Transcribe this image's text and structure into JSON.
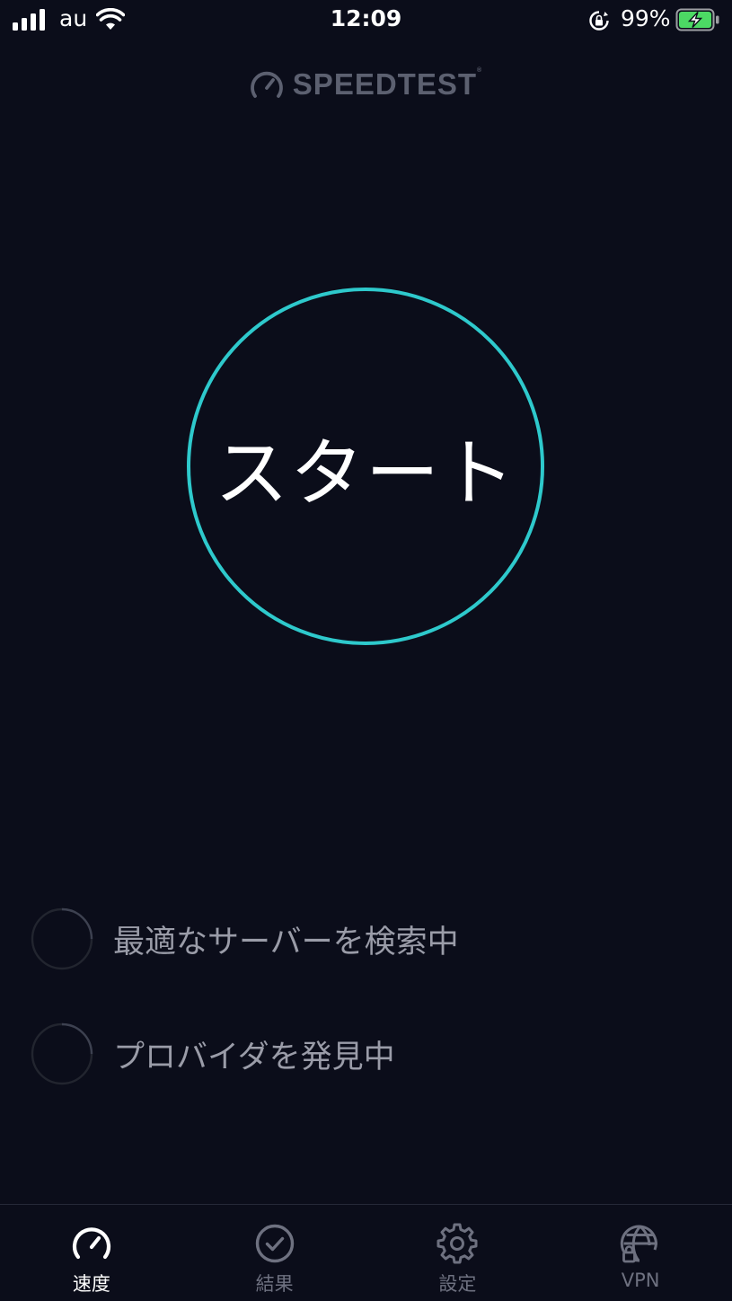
{
  "status_bar": {
    "carrier": "au",
    "time": "12:09",
    "battery_percent": "99%",
    "signal_bars": 4
  },
  "header": {
    "logo_text": "SPEEDTEST",
    "logo_icon": "speedometer-icon"
  },
  "start_button": {
    "label": "スタート",
    "ring_color": "#2ec9cc"
  },
  "status_rows": [
    {
      "text": "最適なサーバーを検索中",
      "icon": "spinner-icon"
    },
    {
      "text": "プロバイダを発見中",
      "icon": "spinner-icon"
    }
  ],
  "tab_bar": {
    "tabs": [
      {
        "label": "速度",
        "icon": "speedometer-icon",
        "active": true
      },
      {
        "label": "結果",
        "icon": "checkmark-circle-icon",
        "active": false
      },
      {
        "label": "設定",
        "icon": "gear-icon",
        "active": false
      },
      {
        "label": "VPN",
        "icon": "globe-lock-icon",
        "active": false
      }
    ]
  },
  "colors": {
    "background": "#0b0d1a",
    "accent": "#2ec9cc",
    "inactive": "#6e7180"
  }
}
